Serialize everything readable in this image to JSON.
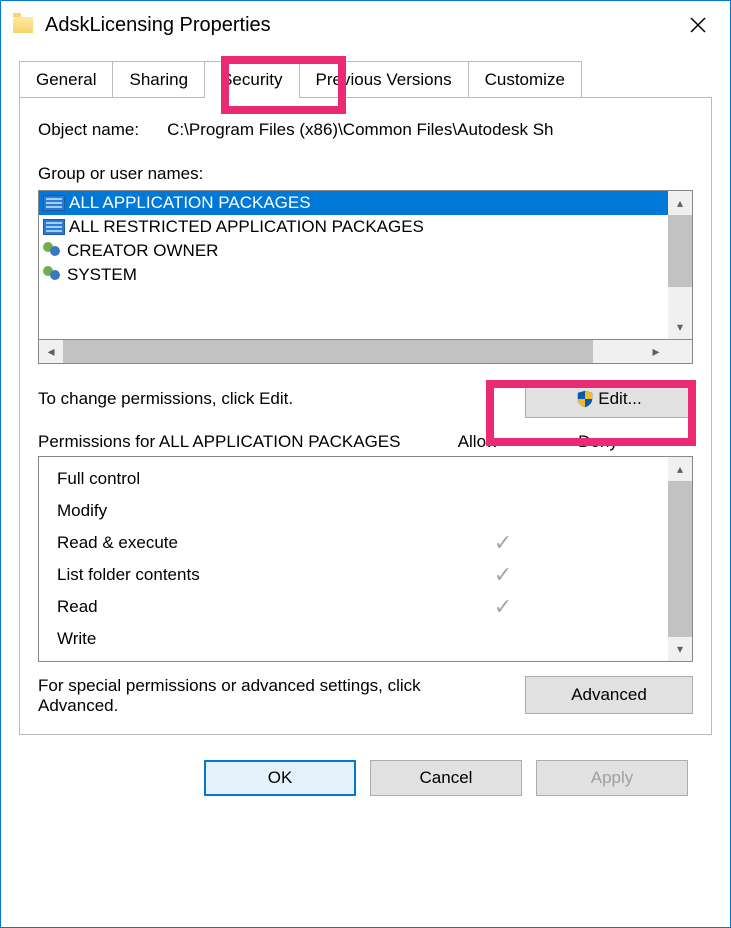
{
  "window": {
    "title": "AdskLicensing Properties"
  },
  "tabs": [
    "General",
    "Sharing",
    "Security",
    "Previous Versions",
    "Customize"
  ],
  "active_tab": 2,
  "object_name_label": "Object name:",
  "object_name": "C:\\Program Files (x86)\\Common Files\\Autodesk Sh",
  "group_label": "Group or user names:",
  "principals": [
    {
      "name": "ALL APPLICATION PACKAGES",
      "icon": "pkg",
      "selected": true
    },
    {
      "name": "ALL RESTRICTED APPLICATION PACKAGES",
      "icon": "pkg",
      "selected": false
    },
    {
      "name": "CREATOR OWNER",
      "icon": "usr",
      "selected": false
    },
    {
      "name": "SYSTEM",
      "icon": "usr",
      "selected": false
    }
  ],
  "change_text": "To change permissions, click Edit.",
  "edit_button": "Edit...",
  "perm_header_for": "Permissions for ALL APPLICATION PACKAGES",
  "perm_col_allow": "Allow",
  "perm_col_deny": "Deny",
  "permissions": [
    {
      "name": "Full control",
      "allow": false,
      "deny": false
    },
    {
      "name": "Modify",
      "allow": false,
      "deny": false
    },
    {
      "name": "Read & execute",
      "allow": true,
      "deny": false
    },
    {
      "name": "List folder contents",
      "allow": true,
      "deny": false
    },
    {
      "name": "Read",
      "allow": true,
      "deny": false
    },
    {
      "name": "Write",
      "allow": false,
      "deny": false
    }
  ],
  "advanced_text": "For special permissions or advanced settings, click Advanced.",
  "advanced_button": "Advanced",
  "buttons": {
    "ok": "OK",
    "cancel": "Cancel",
    "apply": "Apply"
  },
  "highlights": {
    "security_tab": true,
    "edit_button": true
  }
}
